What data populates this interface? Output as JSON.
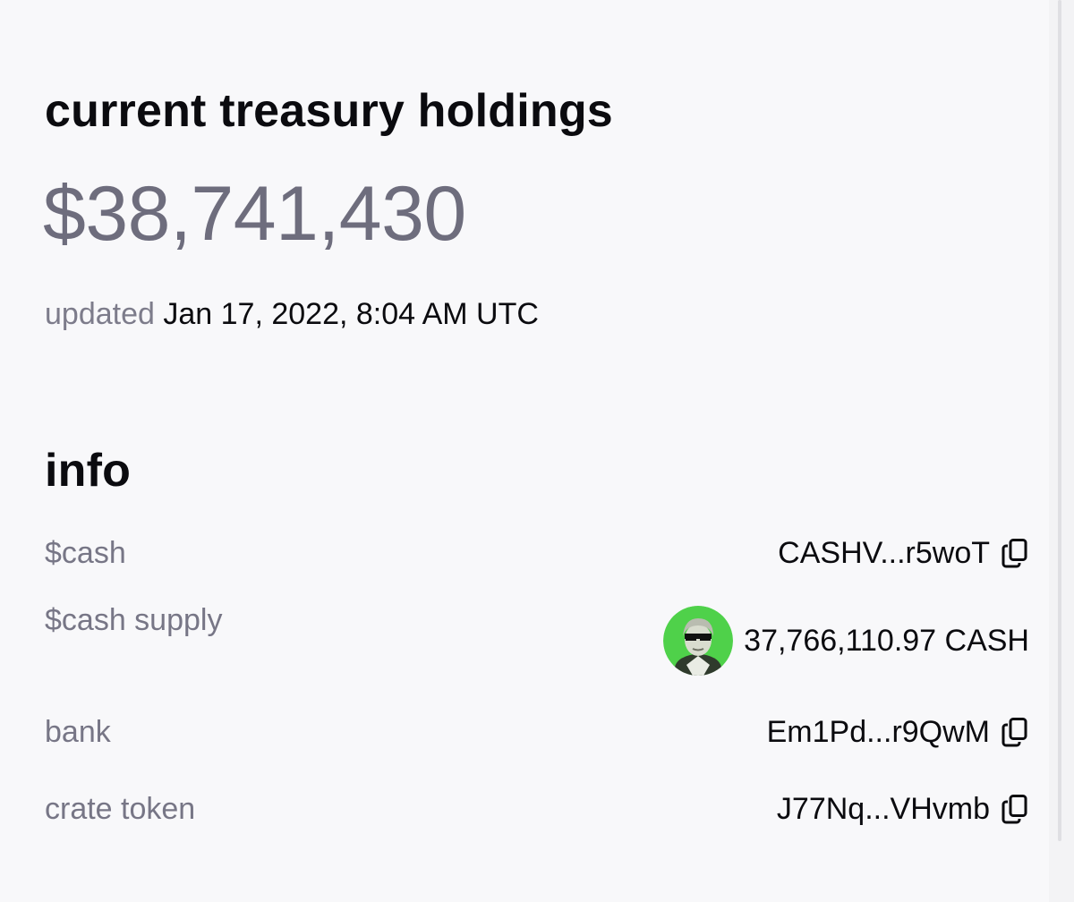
{
  "treasury": {
    "title": "current treasury holdings",
    "amount": "$38,741,430",
    "updated_label": "updated",
    "updated_time": "Jan 17, 2022, 8:04 AM UTC"
  },
  "info": {
    "title": "info",
    "rows": [
      {
        "label": "$cash",
        "value": "CASHV...r5woT",
        "icon": "copy-icon"
      },
      {
        "label": "$cash supply",
        "value": "37,766,110.97 CASH",
        "icon": "token-avatar"
      },
      {
        "label": "bank",
        "value": "Em1Pd...r9QwM",
        "icon": "copy-icon"
      },
      {
        "label": "crate token",
        "value": "J77Nq...VHvmb",
        "icon": "copy-icon"
      }
    ]
  },
  "colors": {
    "background": "#f8f8fa",
    "heading": "#0b0b0f",
    "muted_text": "#777686",
    "amount_text": "#6e6d7d",
    "avatar_green": "#4fd14a"
  }
}
